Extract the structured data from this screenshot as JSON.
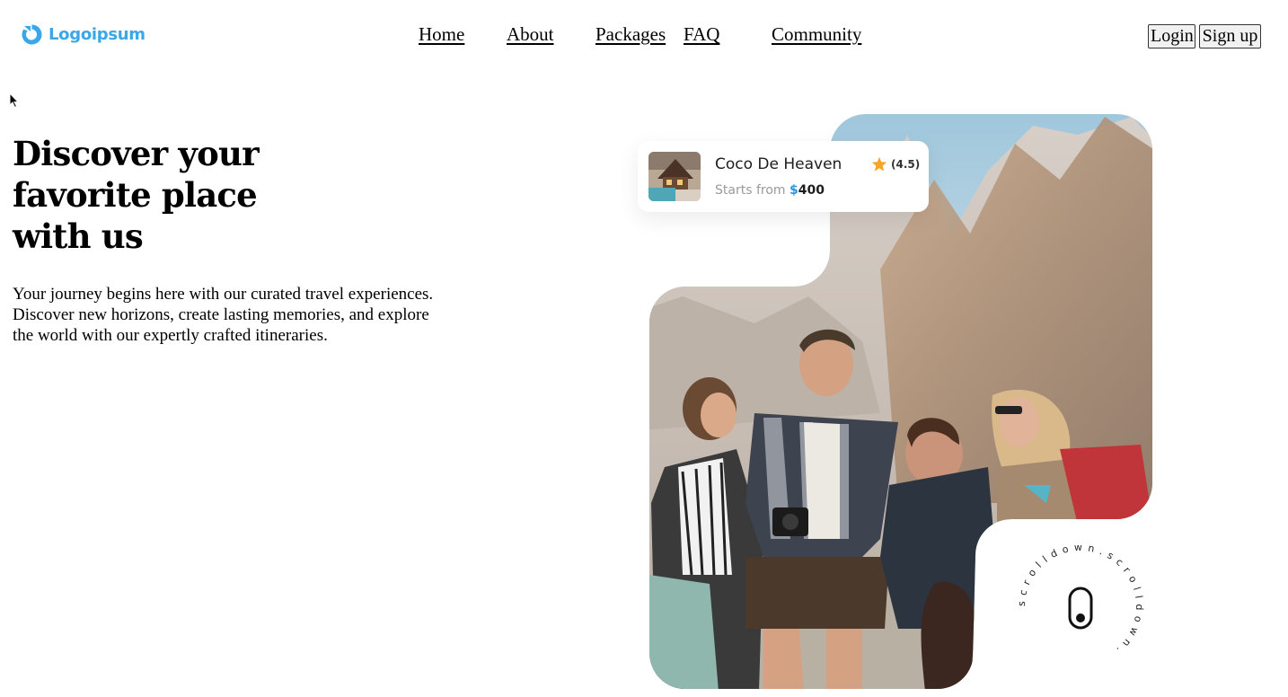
{
  "header": {
    "logo_text": "Logoipsum",
    "nav": [
      {
        "label": "Home"
      },
      {
        "label": "About"
      },
      {
        "label": "Packages"
      },
      {
        "label": "FAQ"
      },
      {
        "label": "Community"
      }
    ],
    "login_label": "Login",
    "signup_label": "Sign up"
  },
  "hero": {
    "title_lines": [
      "Discover your",
      "favorite place",
      "with us"
    ],
    "description_lines": [
      "Your journey begins here with our curated travel experiences.",
      "Discover new horizons, create lasting memories, and explore",
      "the world with our expertly crafted itineraries."
    ]
  },
  "package_card": {
    "name": "Coco De Heaven",
    "rating": "(4.5)",
    "price_prefix": "Starts from ",
    "currency": "$",
    "price": "400"
  },
  "scroll_badge": {
    "text": "s c r o l l  d o w n  .  s c r o l l  d o w n  .  "
  },
  "colors": {
    "brand": "#3aa7e8",
    "price_accent": "#2f95dc",
    "star": "#f5a623"
  },
  "icons": {
    "logo": "logo-mark-icon",
    "star": "star-icon",
    "scroll": "mouse-scroll-icon",
    "cursor": "cursor-arrow-icon"
  }
}
